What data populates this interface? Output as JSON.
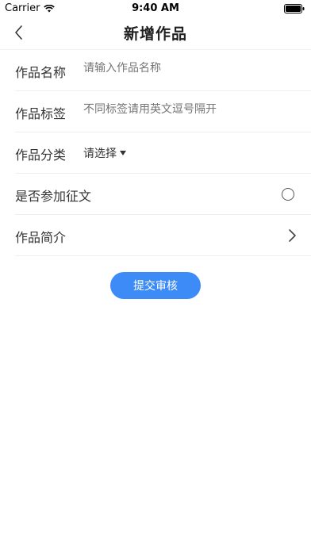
{
  "status_bar": {
    "carrier": "Carrier",
    "time": "9:40 AM"
  },
  "nav": {
    "title": "新增作品",
    "back_icon": "chevron-left-icon"
  },
  "form": {
    "name_label": "作品名称",
    "name_placeholder": "请输入作品名称",
    "tags_label": "作品标签",
    "tags_placeholder": "不同标签请用英文逗号隔开",
    "category_label": "作品分类",
    "category_value": "请选择",
    "contest_label": "是否参加征文",
    "intro_label": "作品简介"
  },
  "submit_label": "提交审核",
  "colors": {
    "accent": "#3d8bf7",
    "divider": "#eeeeee"
  }
}
